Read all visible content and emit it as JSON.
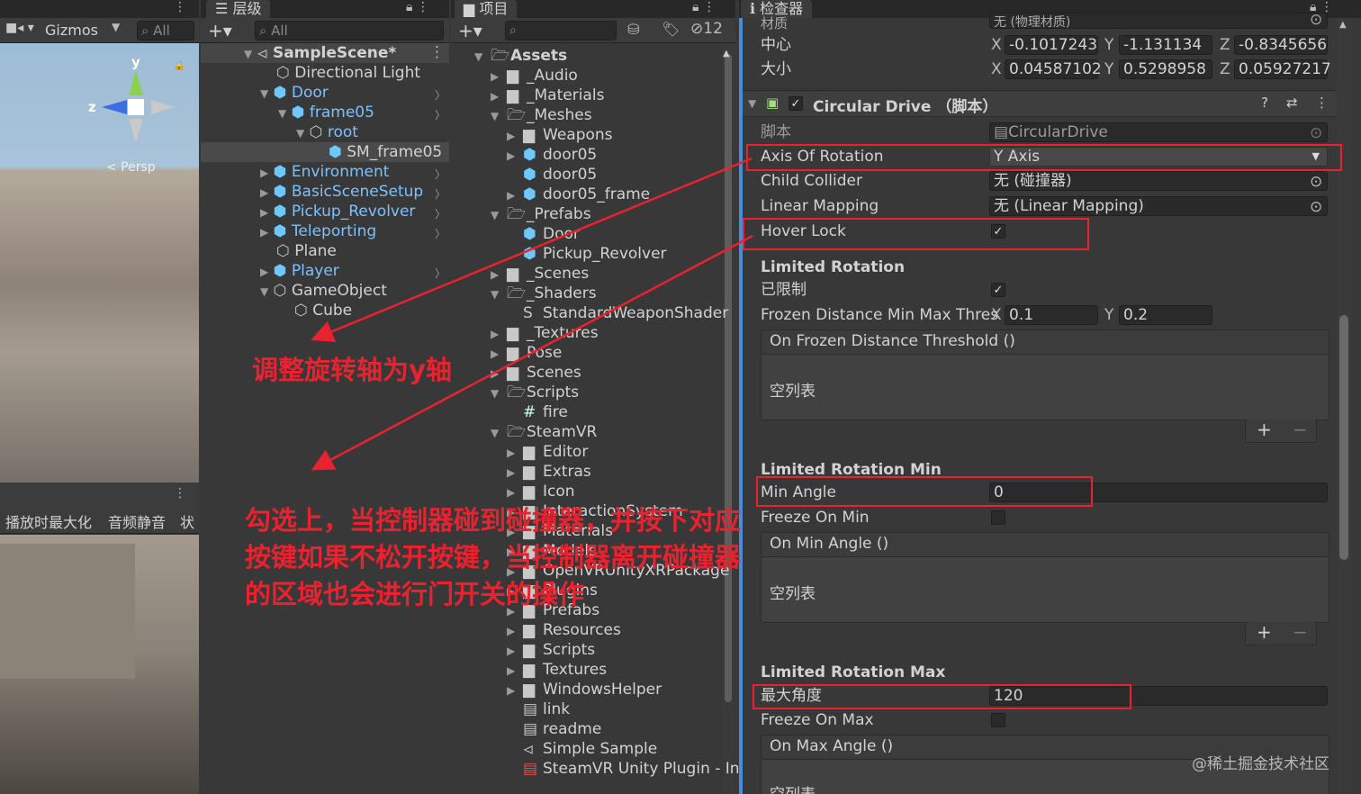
{
  "scene": {
    "gizmos_label": "Gizmos",
    "search_placeholder": "All",
    "persp_label": "< Persp",
    "axis_y": "y",
    "axis_z": "z",
    "game_toolbar": [
      "播放时最大化",
      "音频静音",
      "状"
    ]
  },
  "hierarchy": {
    "tab_label": "层级",
    "search_placeholder": "All",
    "items": [
      {
        "label": "SampleScene*"
      },
      {
        "label": "Directional Light"
      },
      {
        "label": "Door"
      },
      {
        "label": "frame05"
      },
      {
        "label": "root"
      },
      {
        "label": "SM_frame05"
      },
      {
        "label": "Environment"
      },
      {
        "label": "BasicSceneSetup"
      },
      {
        "label": "Pickup_Revolver"
      },
      {
        "label": "Teleporting"
      },
      {
        "label": "Plane"
      },
      {
        "label": "Player"
      },
      {
        "label": "GameObject"
      },
      {
        "label": "Cube"
      }
    ]
  },
  "project": {
    "tab_label": "项目",
    "hidden_count": "12",
    "items": [
      {
        "label": "Assets"
      },
      {
        "label": "_Audio"
      },
      {
        "label": "_Materials"
      },
      {
        "label": "_Meshes"
      },
      {
        "label": "Weapons"
      },
      {
        "label": "door05"
      },
      {
        "label": "door05"
      },
      {
        "label": "door05_frame"
      },
      {
        "label": "_Prefabs"
      },
      {
        "label": "Door"
      },
      {
        "label": "Pickup_Revolver"
      },
      {
        "label": "_Scenes"
      },
      {
        "label": "_Shaders"
      },
      {
        "label": "StandardWeaponShader"
      },
      {
        "label": "_Textures"
      },
      {
        "label": "Pose"
      },
      {
        "label": "Scenes"
      },
      {
        "label": "Scripts"
      },
      {
        "label": "fire"
      },
      {
        "label": "SteamVR"
      },
      {
        "label": "Editor"
      },
      {
        "label": "Extras"
      },
      {
        "label": "Icon"
      },
      {
        "label": "InteractionSystem"
      },
      {
        "label": "Materials"
      },
      {
        "label": "Models"
      },
      {
        "label": "OpenVRUnityXRPackage"
      },
      {
        "label": "Plugins"
      },
      {
        "label": "Prefabs"
      },
      {
        "label": "Resources"
      },
      {
        "label": "Scripts"
      },
      {
        "label": "Textures"
      },
      {
        "label": "WindowsHelper"
      },
      {
        "label": "link"
      },
      {
        "label": "readme"
      },
      {
        "label": "Simple Sample"
      },
      {
        "label": "SteamVR Unity Plugin - Inp"
      }
    ]
  },
  "inspector": {
    "tab_label": "检查器",
    "material_label": "材质",
    "material_value": "无 (物理材质)",
    "center_label": "中心",
    "center": {
      "x": "-0.1017243",
      "y": "-1.131134",
      "z": "-0.8345656"
    },
    "size_label": "大小",
    "size": {
      "x": "0.04587102",
      "y": "0.5298958",
      "z": "0.05927217"
    },
    "component_title": "Circular Drive （脚本）",
    "script_label": "脚本",
    "script_value": "CircularDrive",
    "axis_label": "Axis Of Rotation",
    "axis_value": "Y Axis",
    "child_collider_label": "Child Collider",
    "child_collider_value": "无 (碰撞器)",
    "linear_mapping_label": "Linear Mapping",
    "linear_mapping_value": "无 (Linear Mapping)",
    "hover_lock_label": "Hover Lock",
    "limited_rotation_header": "Limited Rotation",
    "limited_label": "已限制",
    "frozen_label": "Frozen Distance Min Max Thres",
    "frozen_x": "0.1",
    "frozen_y": "0.2",
    "on_frozen_event": "On Frozen Distance Threshold ()",
    "empty_list": "空列表",
    "limited_min_header": "Limited Rotation Min",
    "min_angle_label": "Min Angle",
    "min_angle_value": "0",
    "freeze_min_label": "Freeze On Min",
    "on_min_event": "On Min Angle ()",
    "limited_max_header": "Limited Rotation Max",
    "max_angle_label": "最大角度",
    "max_angle_value": "120",
    "freeze_max_label": "Freeze On Max",
    "on_max_event": "On Max Angle ()",
    "plus": "+",
    "minus": "−"
  },
  "annotations": {
    "rotate_axis_note": "调整旋转轴为y轴",
    "hover_lock_note_lines": [
      "勾选上，当控制器碰到碰撞器，并按下对应",
      "按键如果不松开按键，当控制器离开碰撞器",
      "的区域也会进行门开关的操作"
    ],
    "watermark": "@稀土掘金技术社区",
    "color": "#e8222f"
  }
}
